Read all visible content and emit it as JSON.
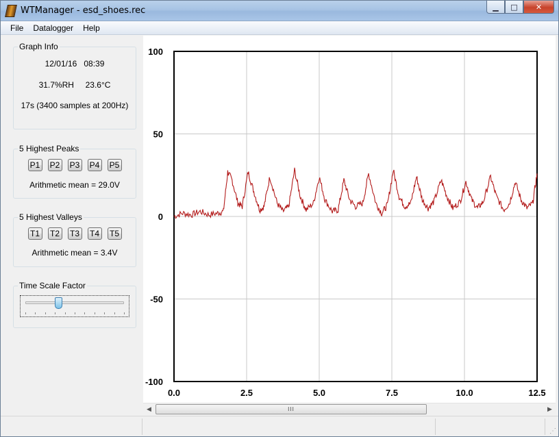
{
  "window": {
    "title": "WTManager - esd_shoes.rec",
    "icon": "app-logo-icon",
    "controls": {
      "minimize": "minimize-icon",
      "maximize": "maximize-icon",
      "close": "close-icon"
    }
  },
  "menu": {
    "items": [
      "File",
      "Datalogger",
      "Help"
    ]
  },
  "graph_info": {
    "title": "Graph Info",
    "date": "12/01/16",
    "time": "08:39",
    "humidity": "31.7%RH",
    "temperature": "23.6°C",
    "duration": "17s (3400 samples at 200Hz)"
  },
  "peaks": {
    "title": "5 Highest Peaks",
    "buttons": [
      "P1",
      "P2",
      "P3",
      "P4",
      "P5"
    ],
    "mean": "Arithmetic mean = 29.0V"
  },
  "valleys": {
    "title": "5 Highest Valleys",
    "buttons": [
      "T1",
      "T2",
      "T3",
      "T4",
      "T5"
    ],
    "mean": "Arithmetic mean = 3.4V"
  },
  "time_scale": {
    "title": "Time Scale Factor",
    "value_fraction": 0.33
  },
  "scrollbar": {
    "thumb_grip": "III",
    "thumb_fraction": 0.7
  },
  "colors": {
    "trace": "#b31b1b",
    "grid": "#c8c8c8",
    "window_bg": "#f0f0f0"
  },
  "chart_data": {
    "type": "line",
    "title": "",
    "xlabel": "",
    "ylabel": "",
    "xlim": [
      0,
      12.5
    ],
    "ylim": [
      -100,
      100
    ],
    "x_ticks": [
      "0.0",
      "2.5",
      "5.0",
      "7.5",
      "10.0",
      "12.5"
    ],
    "y_ticks": [
      "100",
      "50",
      "0",
      "-50",
      "-100"
    ],
    "grid": true,
    "series": [
      {
        "color": "#b31b1b",
        "points": [
          [
            0.0,
            0
          ],
          [
            0.3,
            2
          ],
          [
            0.6,
            1
          ],
          [
            0.9,
            3
          ],
          [
            1.2,
            1
          ],
          [
            1.5,
            2
          ],
          [
            1.7,
            3
          ],
          [
            1.85,
            27
          ],
          [
            2.0,
            22
          ],
          [
            2.2,
            8
          ],
          [
            2.35,
            6
          ],
          [
            2.55,
            27
          ],
          [
            2.75,
            15
          ],
          [
            2.95,
            4
          ],
          [
            3.1,
            6
          ],
          [
            3.3,
            24
          ],
          [
            3.55,
            8
          ],
          [
            3.75,
            3
          ],
          [
            3.95,
            6
          ],
          [
            4.15,
            28
          ],
          [
            4.35,
            12
          ],
          [
            4.55,
            4
          ],
          [
            4.8,
            8
          ],
          [
            5.0,
            24
          ],
          [
            5.2,
            10
          ],
          [
            5.45,
            3
          ],
          [
            5.65,
            4
          ],
          [
            5.85,
            22
          ],
          [
            6.05,
            10
          ],
          [
            6.25,
            6
          ],
          [
            6.5,
            8
          ],
          [
            6.7,
            26
          ],
          [
            6.95,
            8
          ],
          [
            7.15,
            2
          ],
          [
            7.35,
            7
          ],
          [
            7.55,
            28
          ],
          [
            7.75,
            12
          ],
          [
            7.95,
            6
          ],
          [
            8.15,
            8
          ],
          [
            8.35,
            24
          ],
          [
            8.55,
            10
          ],
          [
            8.75,
            5
          ],
          [
            8.95,
            9
          ],
          [
            9.2,
            22
          ],
          [
            9.4,
            12
          ],
          [
            9.6,
            5
          ],
          [
            9.85,
            9
          ],
          [
            10.05,
            21
          ],
          [
            10.25,
            10
          ],
          [
            10.45,
            5
          ],
          [
            10.65,
            9
          ],
          [
            10.9,
            24
          ],
          [
            11.1,
            12
          ],
          [
            11.35,
            4
          ],
          [
            11.55,
            8
          ],
          [
            11.75,
            21
          ],
          [
            11.95,
            10
          ],
          [
            12.15,
            5
          ],
          [
            12.35,
            8
          ],
          [
            12.5,
            26
          ]
        ]
      }
    ]
  }
}
